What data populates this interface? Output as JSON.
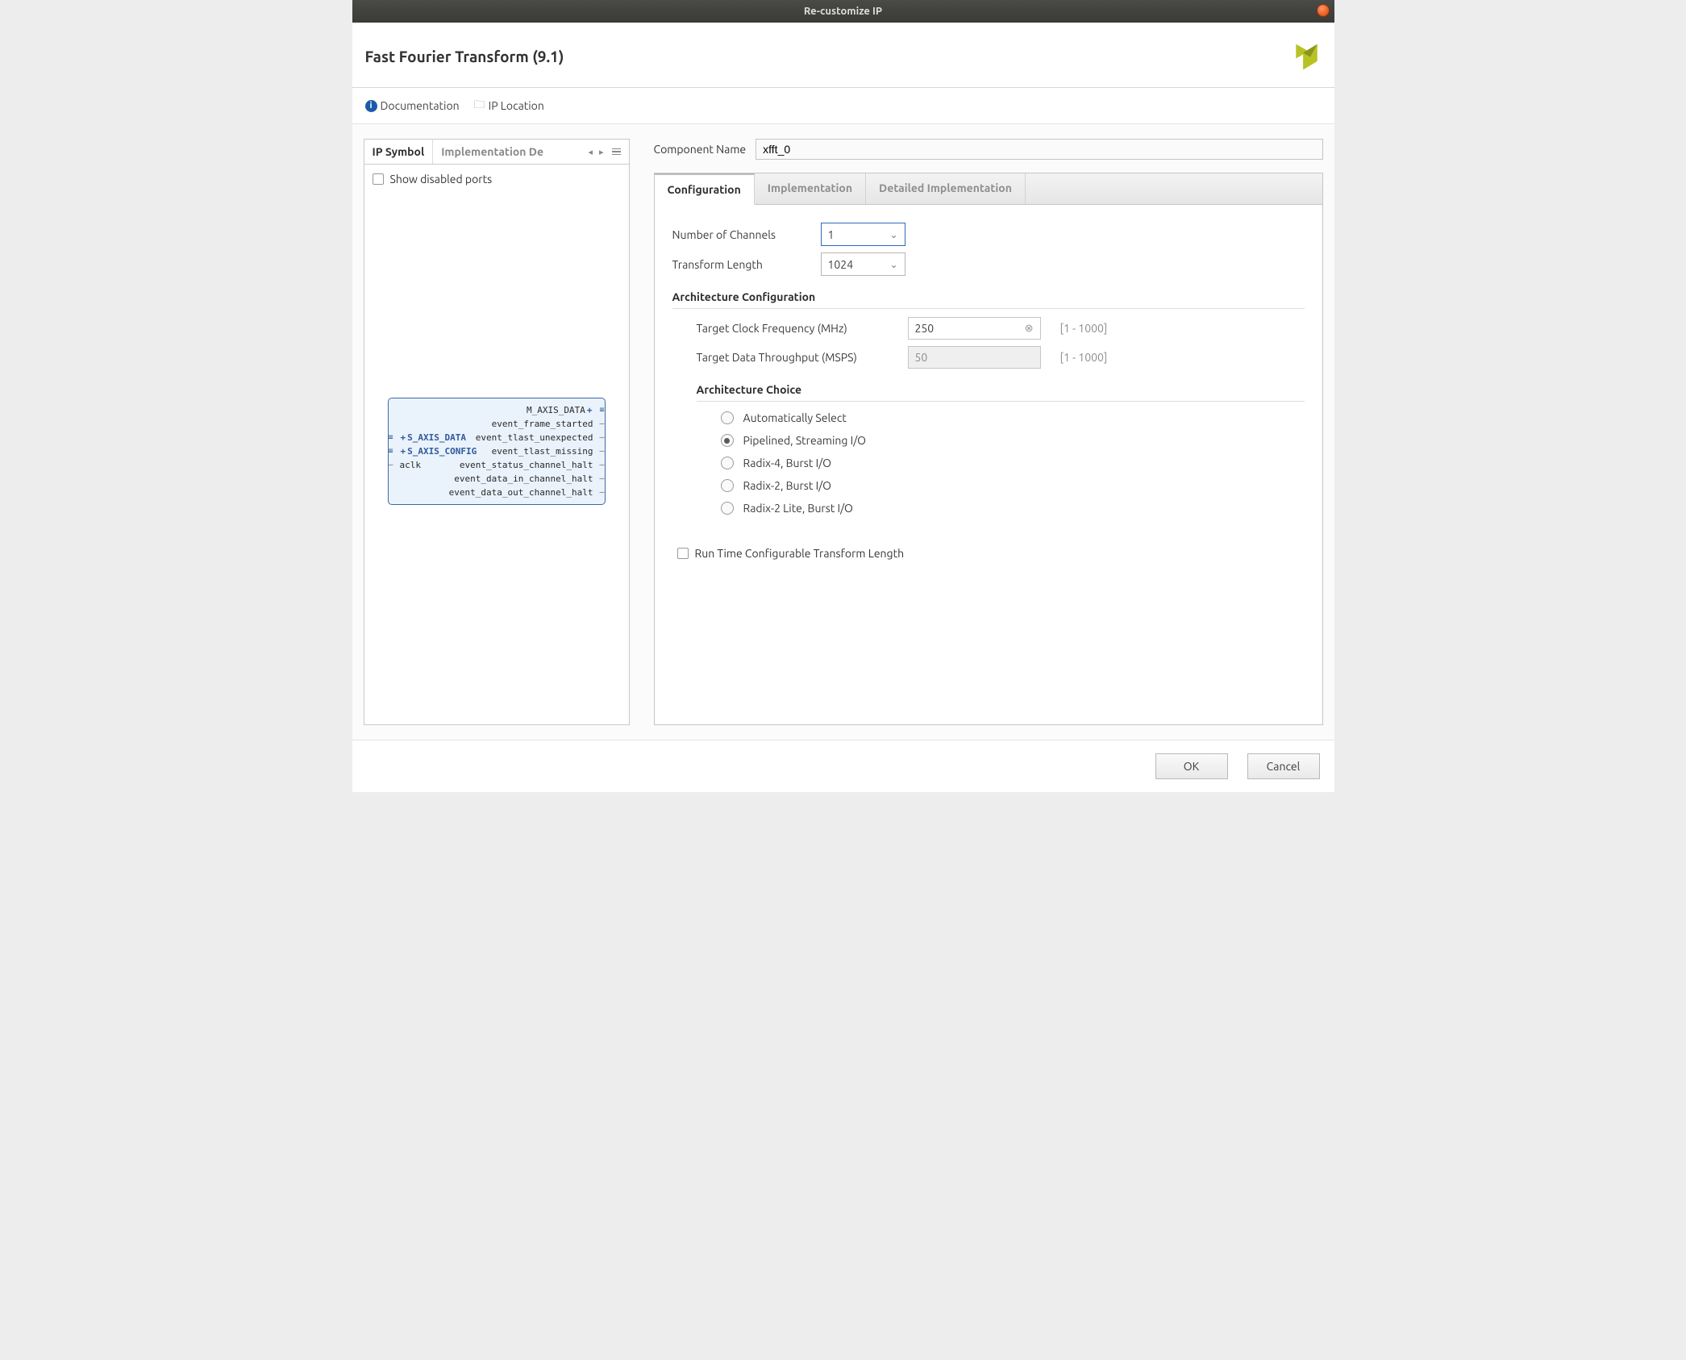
{
  "window": {
    "title": "Re-customize IP"
  },
  "header": {
    "title": "Fast Fourier Transform (9.1)"
  },
  "linkbar": {
    "documentation": "Documentation",
    "ip_location": "IP Location"
  },
  "left": {
    "tabs": {
      "symbol": "IP Symbol",
      "impl": "Implementation De"
    },
    "show_disabled": "Show disabled ports",
    "ports": {
      "left": [
        "S_AXIS_DATA",
        "S_AXIS_CONFIG",
        "aclk"
      ],
      "right": [
        "M_AXIS_DATA",
        "event_frame_started",
        "event_tlast_unexpected",
        "event_tlast_missing",
        "event_status_channel_halt",
        "event_data_in_channel_halt",
        "event_data_out_channel_halt"
      ]
    }
  },
  "component": {
    "label": "Component Name",
    "value": "xfft_0"
  },
  "main_tabs": {
    "config": "Configuration",
    "impl": "Implementation",
    "detail": "Detailed Implementation"
  },
  "config": {
    "num_channels": {
      "label": "Number of Channels",
      "value": "1"
    },
    "transform_len": {
      "label": "Transform Length",
      "value": "1024"
    },
    "arch_head": "Architecture Configuration",
    "clock": {
      "label": "Target Clock Frequency (MHz)",
      "value": "250",
      "range": "[1 - 1000]"
    },
    "throughput": {
      "label": "Target Data Throughput (MSPS)",
      "value": "50",
      "range": "[1 - 1000]"
    },
    "choice_head": "Architecture Choice",
    "choices": [
      "Automatically Select",
      "Pipelined, Streaming I/O",
      "Radix-4, Burst I/O",
      "Radix-2, Burst I/O",
      "Radix-2 Lite, Burst I/O"
    ],
    "runtime": "Run Time Configurable Transform Length"
  },
  "footer": {
    "ok": "OK",
    "cancel": "Cancel"
  }
}
